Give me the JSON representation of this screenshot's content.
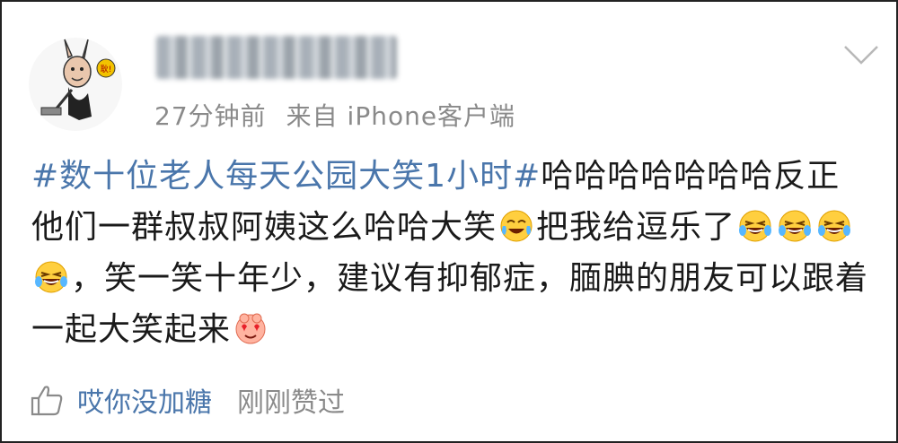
{
  "post": {
    "author_name": "",
    "time_ago": "27分钟前",
    "source": "来自 iPhone客户端",
    "topic": "#数十位老人每天公园大笑1小时#",
    "segments": [
      {
        "type": "topic",
        "text": "#数十位老人每天公园大笑1小时#"
      },
      {
        "type": "text",
        "text": "哈哈哈哈哈哈哈反正他们一群叔叔阿姨这么哈哈大笑"
      },
      {
        "type": "emoji",
        "icon": "crying-laughing-emoji"
      },
      {
        "type": "text",
        "text": "把我给逗乐了"
      },
      {
        "type": "emoji",
        "icon": "laughing-tears-emoji"
      },
      {
        "type": "emoji",
        "icon": "laughing-tears-emoji"
      },
      {
        "type": "emoji",
        "icon": "laughing-tears-emoji"
      },
      {
        "type": "emoji",
        "icon": "laughing-tears-emoji"
      },
      {
        "type": "text",
        "text": "，笑一笑十年少，建议有抑郁症，腼腆的朋友可以跟着一起大笑起来"
      },
      {
        "type": "emoji",
        "icon": "heart-eyes-emoji"
      }
    ],
    "text_1": "哈哈哈哈哈哈哈反正他们一群叔叔阿姨这么哈哈大笑",
    "text_2": "把我给逗乐了",
    "text_3": "，笑一笑十年少，建议有抑郁症，腼腆的朋友可以跟着一起大笑起来"
  },
  "footer": {
    "liker_name": "哎你没加糖",
    "liked_text": "刚刚赞过"
  },
  "colors": {
    "link": "#4a76ab",
    "meta": "#8a8a8a",
    "text": "#1a1a1a"
  },
  "icons": [
    "avatar-cartoon",
    "chevron-down-icon",
    "thumbs-up-icon",
    "crying-laughing-emoji",
    "laughing-tears-emoji",
    "heart-eyes-emoji"
  ]
}
